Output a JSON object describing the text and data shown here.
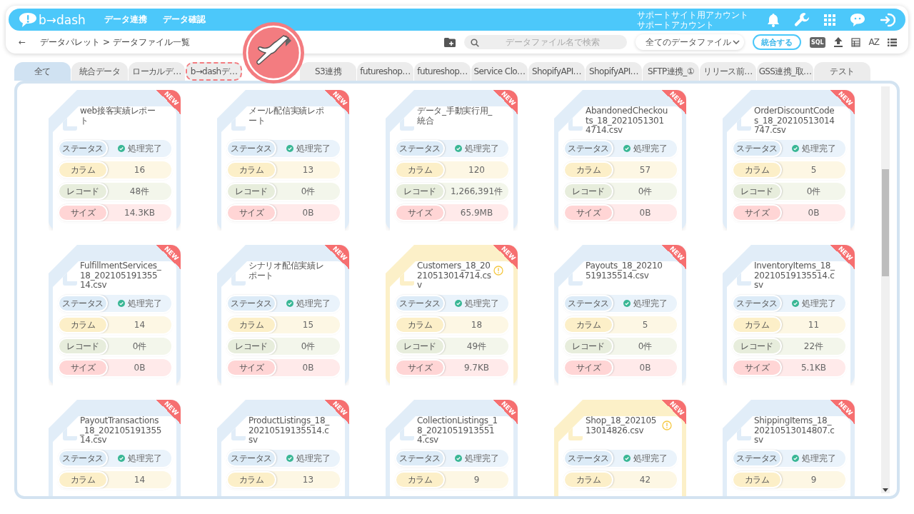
{
  "header": {
    "logo": "b→dash",
    "nav": [
      "データ連携",
      "データ確認"
    ],
    "account": [
      "サポートサイト用アカウント",
      "サポートアカウント"
    ]
  },
  "toolbar": {
    "back": "←",
    "breadcrumb": "データパレット > データファイル一覧",
    "search": {
      "placeholder": "データファイル名で検索"
    },
    "filter": "全てのデータファイル",
    "merge_button": "統合する",
    "sql_label": "SQL",
    "sort_label": "AZ"
  },
  "tabs": [
    {
      "label": "全て",
      "selected": true,
      "highlighted": false
    },
    {
      "label": "統合データ",
      "selected": false,
      "highlighted": false
    },
    {
      "label": "ローカルデ…",
      "selected": false,
      "highlighted": false
    },
    {
      "label": "b→dashデ…",
      "selected": false,
      "highlighted": true
    },
    {
      "kind": "hidden"
    },
    {
      "label": "S3連携",
      "selected": false,
      "highlighted": false
    },
    {
      "label": "futureshop…",
      "selected": false,
      "highlighted": false
    },
    {
      "label": "futureshop…",
      "selected": false,
      "highlighted": false
    },
    {
      "label": "Service Clo…",
      "selected": false,
      "highlighted": false
    },
    {
      "label": "ShopifyAPI…",
      "selected": false,
      "highlighted": false
    },
    {
      "label": "ShopifyAPI…",
      "selected": false,
      "highlighted": false
    },
    {
      "label": "SFTP連携_①",
      "selected": false,
      "highlighted": false
    },
    {
      "label": "リリース前…",
      "selected": false,
      "highlighted": false
    },
    {
      "label": "GSS連携_取…",
      "selected": false,
      "highlighted": false
    },
    {
      "label": "テスト",
      "selected": false,
      "highlighted": false
    }
  ],
  "callout": {
    "kind": "pointing-hand"
  },
  "cards": [
    {
      "title": "web接客実績レポート",
      "new": "NEW",
      "warning": false,
      "fields": [
        {
          "kind": "status",
          "label": "ステータス",
          "value": "処理完了"
        },
        {
          "kind": "columns",
          "label": "カラム",
          "value": "16"
        },
        {
          "kind": "records",
          "label": "レコード",
          "value": "48件"
        },
        {
          "kind": "size",
          "label": "サイズ",
          "value": "14.3KB"
        }
      ]
    },
    {
      "title": "メール配信実績レポート",
      "new": "NEW",
      "warning": false,
      "fields": [
        {
          "kind": "status",
          "label": "ステータス",
          "value": "処理完了"
        },
        {
          "kind": "columns",
          "label": "カラム",
          "value": "13"
        },
        {
          "kind": "records",
          "label": "レコード",
          "value": "0件"
        },
        {
          "kind": "size",
          "label": "サイズ",
          "value": "0B"
        }
      ]
    },
    {
      "title": "データ_手動実行用_統合",
      "new": "NEW",
      "warning": false,
      "fields": [
        {
          "kind": "status",
          "label": "ステータス",
          "value": "処理完了"
        },
        {
          "kind": "columns",
          "label": "カラム",
          "value": "120"
        },
        {
          "kind": "records",
          "label": "レコード",
          "value": "1,266,391件"
        },
        {
          "kind": "size",
          "label": "サイズ",
          "value": "65.9MB"
        }
      ]
    },
    {
      "title": "AbandonedCheckouts_18_20210513014714.csv",
      "new": "NEW",
      "warning": false,
      "fields": [
        {
          "kind": "status",
          "label": "ステータス",
          "value": "処理完了"
        },
        {
          "kind": "columns",
          "label": "カラム",
          "value": "57"
        },
        {
          "kind": "records",
          "label": "レコード",
          "value": "0件"
        },
        {
          "kind": "size",
          "label": "サイズ",
          "value": "0B"
        }
      ]
    },
    {
      "title": "OrderDiscountCodes_18_20210513014747.csv",
      "new": "NEW",
      "warning": false,
      "fields": [
        {
          "kind": "status",
          "label": "ステータス",
          "value": "処理完了"
        },
        {
          "kind": "columns",
          "label": "カラム",
          "value": "5"
        },
        {
          "kind": "records",
          "label": "レコード",
          "value": "0件"
        },
        {
          "kind": "size",
          "label": "サイズ",
          "value": "0B"
        }
      ]
    },
    {
      "title": "FulfillmentServices_18_20210519135514.csv",
      "new": "NEW",
      "warning": false,
      "fields": [
        {
          "kind": "status",
          "label": "ステータス",
          "value": "処理完了"
        },
        {
          "kind": "columns",
          "label": "カラム",
          "value": "14"
        },
        {
          "kind": "records",
          "label": "レコード",
          "value": "0件"
        },
        {
          "kind": "size",
          "label": "サイズ",
          "value": "0B"
        }
      ]
    },
    {
      "title": "シナリオ配信実績レポート",
      "new": "NEW",
      "warning": false,
      "fields": [
        {
          "kind": "status",
          "label": "ステータス",
          "value": "処理完了"
        },
        {
          "kind": "columns",
          "label": "カラム",
          "value": "15"
        },
        {
          "kind": "records",
          "label": "レコード",
          "value": "0件"
        },
        {
          "kind": "size",
          "label": "サイズ",
          "value": "0B"
        }
      ]
    },
    {
      "title": "Customers_18_20210513014714.csv",
      "new": "NEW",
      "warning": true,
      "fields": [
        {
          "kind": "status",
          "label": "ステータス",
          "value": "処理完了"
        },
        {
          "kind": "columns",
          "label": "カラム",
          "value": "18"
        },
        {
          "kind": "records",
          "label": "レコード",
          "value": "49件"
        },
        {
          "kind": "size",
          "label": "サイズ",
          "value": "9.7KB"
        }
      ]
    },
    {
      "title": "Payouts_18_20210519135514.csv",
      "new": "NEW",
      "warning": false,
      "fields": [
        {
          "kind": "status",
          "label": "ステータス",
          "value": "処理完了"
        },
        {
          "kind": "columns",
          "label": "カラム",
          "value": "5"
        },
        {
          "kind": "records",
          "label": "レコード",
          "value": "0件"
        },
        {
          "kind": "size",
          "label": "サイズ",
          "value": "0B"
        }
      ]
    },
    {
      "title": "InventoryItems_18_20210519135514.csv",
      "new": "NEW",
      "warning": false,
      "fields": [
        {
          "kind": "status",
          "label": "ステータス",
          "value": "処理完了"
        },
        {
          "kind": "columns",
          "label": "カラム",
          "value": "11"
        },
        {
          "kind": "records",
          "label": "レコード",
          "value": "22件"
        },
        {
          "kind": "size",
          "label": "サイズ",
          "value": "5.1KB"
        }
      ]
    },
    {
      "title": "PayoutTransactions_18_20210519135514.csv",
      "new": "NEW",
      "warning": false,
      "fields": [
        {
          "kind": "status",
          "label": "ステータス",
          "value": "処理完了"
        },
        {
          "kind": "columns",
          "label": "カラム",
          "value": "14"
        }
      ]
    },
    {
      "title": "ProductListings_18_20210519135514.csv",
      "new": "NEW",
      "warning": false,
      "fields": [
        {
          "kind": "status",
          "label": "ステータス",
          "value": "処理完了"
        },
        {
          "kind": "columns",
          "label": "カラム",
          "value": "13"
        }
      ]
    },
    {
      "title": "CollectionListings_18_20210519135514.csv",
      "new": "NEW",
      "warning": false,
      "fields": [
        {
          "kind": "status",
          "label": "ステータス",
          "value": "処理完了"
        },
        {
          "kind": "columns",
          "label": "カラム",
          "value": "9"
        }
      ]
    },
    {
      "title": "Shop_18_20210513014826.csv",
      "new": "NEW",
      "warning": true,
      "fields": [
        {
          "kind": "status",
          "label": "ステータス",
          "value": "処理完了"
        },
        {
          "kind": "columns",
          "label": "カラム",
          "value": "42"
        }
      ]
    },
    {
      "title": "ShippingItems_18_20210513014807.csv",
      "new": "NEW",
      "warning": false,
      "fields": [
        {
          "kind": "status",
          "label": "ステータス",
          "value": "処理完了"
        },
        {
          "kind": "columns",
          "label": "カラム",
          "value": "9"
        }
      ]
    }
  ]
}
